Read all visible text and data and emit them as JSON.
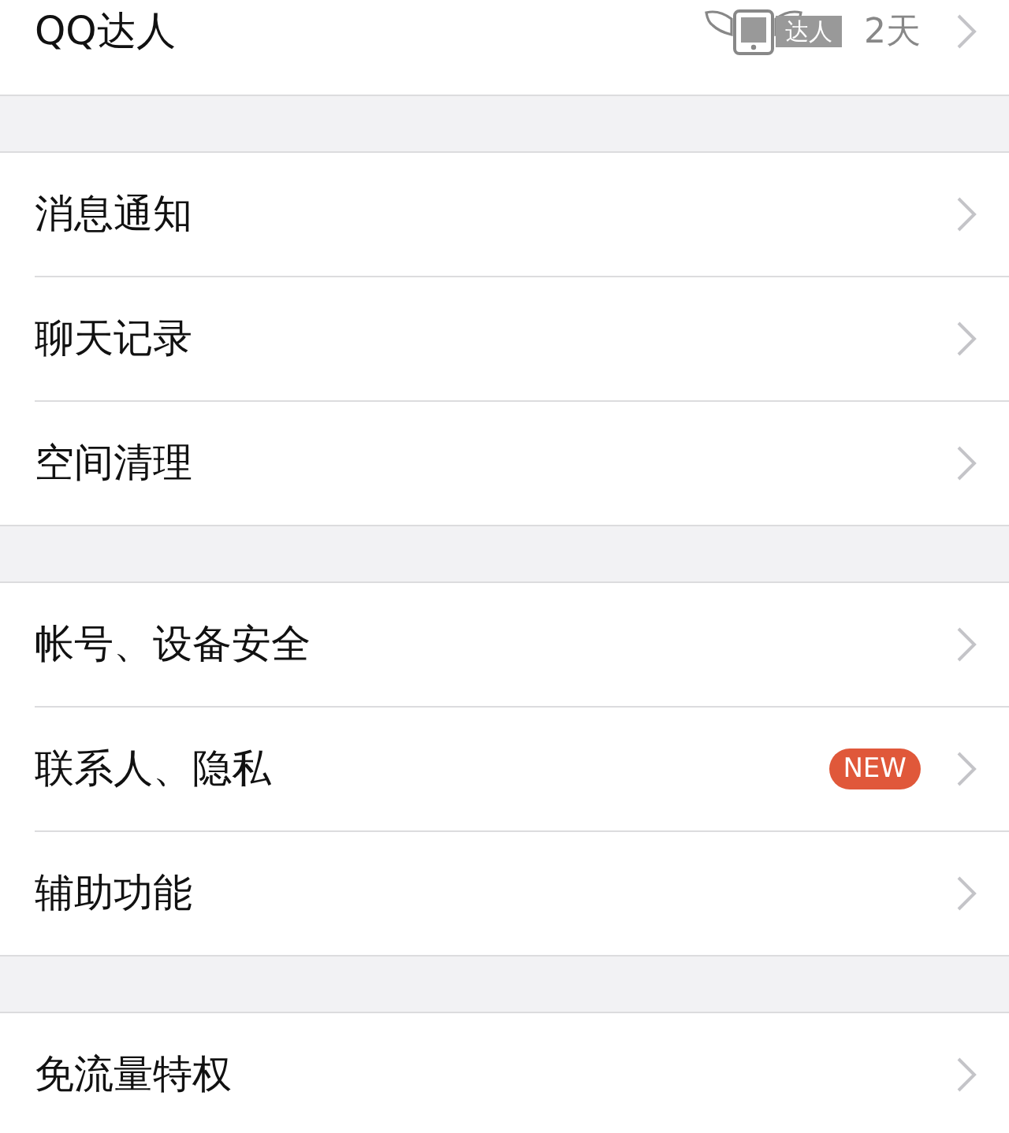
{
  "sections": [
    {
      "items": [
        {
          "label": "QQ达人",
          "badge": {
            "kind": "talent",
            "text": "达人"
          },
          "value": "2天"
        }
      ]
    },
    {
      "items": [
        {
          "label": "消息通知"
        },
        {
          "label": "聊天记录"
        },
        {
          "label": "空间清理"
        }
      ]
    },
    {
      "items": [
        {
          "label": "帐号、设备安全"
        },
        {
          "label": "联系人、隐私",
          "badge": {
            "kind": "new",
            "text": "NEW"
          }
        },
        {
          "label": "辅助功能"
        }
      ]
    },
    {
      "items": [
        {
          "label": "免流量特权"
        }
      ]
    }
  ]
}
